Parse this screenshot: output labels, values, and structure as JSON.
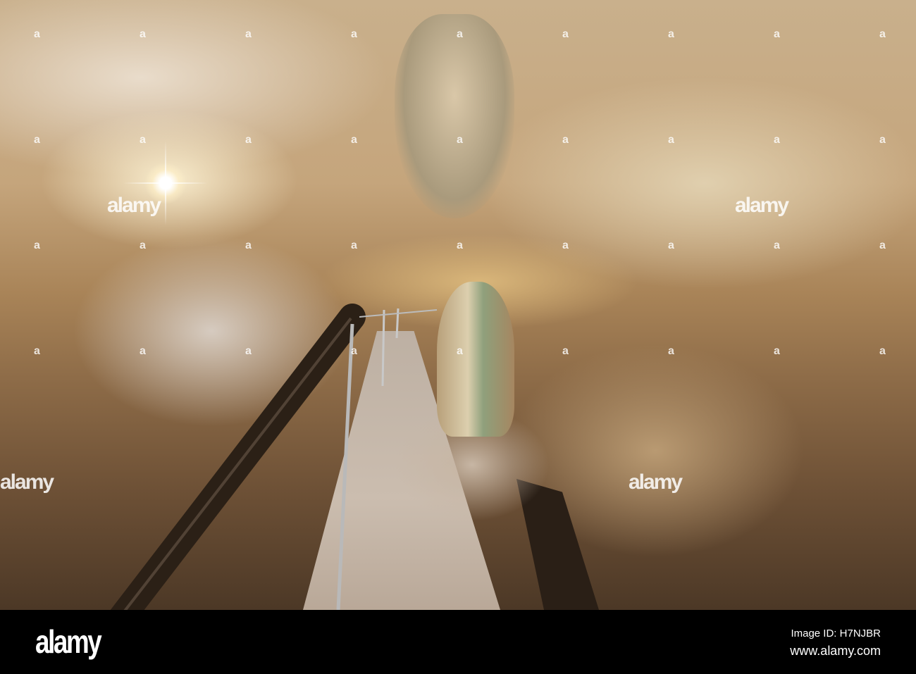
{
  "photo": {
    "subject": "cave-interior-with-handrail"
  },
  "watermark": {
    "text": "alamy",
    "mark": "a"
  },
  "footer": {
    "logo": "alamy",
    "image_id": "Image ID: H7NJBR",
    "url": "www.alamy.com"
  }
}
